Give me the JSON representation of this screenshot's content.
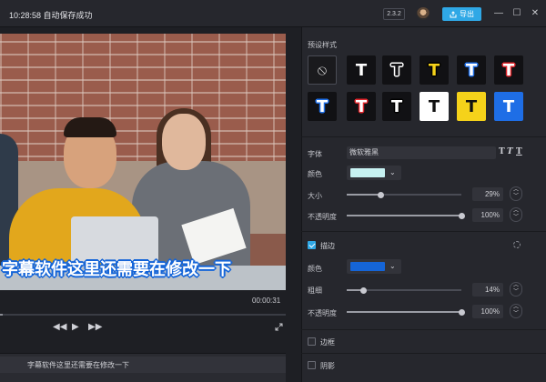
{
  "titlebar": {
    "status": "10:28:58 自动保存成功",
    "version": "2.3.2",
    "export_label": "导出",
    "minimize": "—",
    "maximize": "☐",
    "close": "✕"
  },
  "player": {
    "subtitle_overlay": "字幕软件这里还需要在修改一下",
    "time": "00:00:31",
    "progress_fraction": 0.01
  },
  "subtitle_list": {
    "items": [
      {
        "text": "字幕软件这里还需要在修改一下"
      }
    ]
  },
  "panel": {
    "presets_title": "预设样式",
    "presets": [
      {
        "glyph": "⃠",
        "bg": "#1a1a1d",
        "fill": "#d8d8d8",
        "stroke": "",
        "border": "#4a4c55"
      },
      {
        "glyph": "T",
        "bg": "#111114",
        "fill": "#ffffff",
        "stroke": ""
      },
      {
        "glyph": "T",
        "bg": "#111114",
        "fill": "#111114",
        "stroke": "#ffffff"
      },
      {
        "glyph": "T",
        "bg": "#111114",
        "fill": "#f5d21a",
        "stroke": "#000000"
      },
      {
        "glyph": "T",
        "bg": "#111114",
        "fill": "#ffffff",
        "stroke": "#1e6ee6"
      },
      {
        "glyph": "T",
        "bg": "#111114",
        "fill": "#ffffff",
        "stroke": "#e0262c"
      },
      {
        "glyph": "T",
        "bg": "#111114",
        "fill": "#ffffff",
        "stroke": "#1e6ee6"
      },
      {
        "glyph": "T",
        "bg": "#111114",
        "fill": "#ffffff",
        "stroke": "#e0262c"
      },
      {
        "glyph": "T",
        "bg": "#111114",
        "fill": "#ffffff",
        "stroke": "#000000"
      },
      {
        "glyph": "T",
        "bg": "#ffffff",
        "fill": "#111111",
        "stroke": ""
      },
      {
        "glyph": "T",
        "bg": "#f5d21a",
        "fill": "#111111",
        "stroke": ""
      },
      {
        "glyph": "T",
        "bg": "#1e6ee6",
        "fill": "#ffffff",
        "stroke": ""
      }
    ],
    "font_label": "字体",
    "font_value": "微软雅黑",
    "color_label": "颜色",
    "text_color": "#c7f2f2",
    "size_label": "大小",
    "size_value": "29%",
    "size_fraction": 0.29,
    "opacity_label": "不透明度",
    "opacity_value": "100%",
    "opacity_fraction": 1.0,
    "stroke_label": "描边",
    "stroke_color_label": "颜色",
    "stroke_color": "#1565d8",
    "thickness_label": "粗细",
    "thickness_value": "14%",
    "thickness_fraction": 0.14,
    "stroke_opacity_label": "不透明度",
    "stroke_opacity_value": "100%",
    "stroke_opacity_fraction": 1.0,
    "border_label": "边框",
    "shadow_label": "阴影",
    "accent_color": "#2fa8e6"
  }
}
